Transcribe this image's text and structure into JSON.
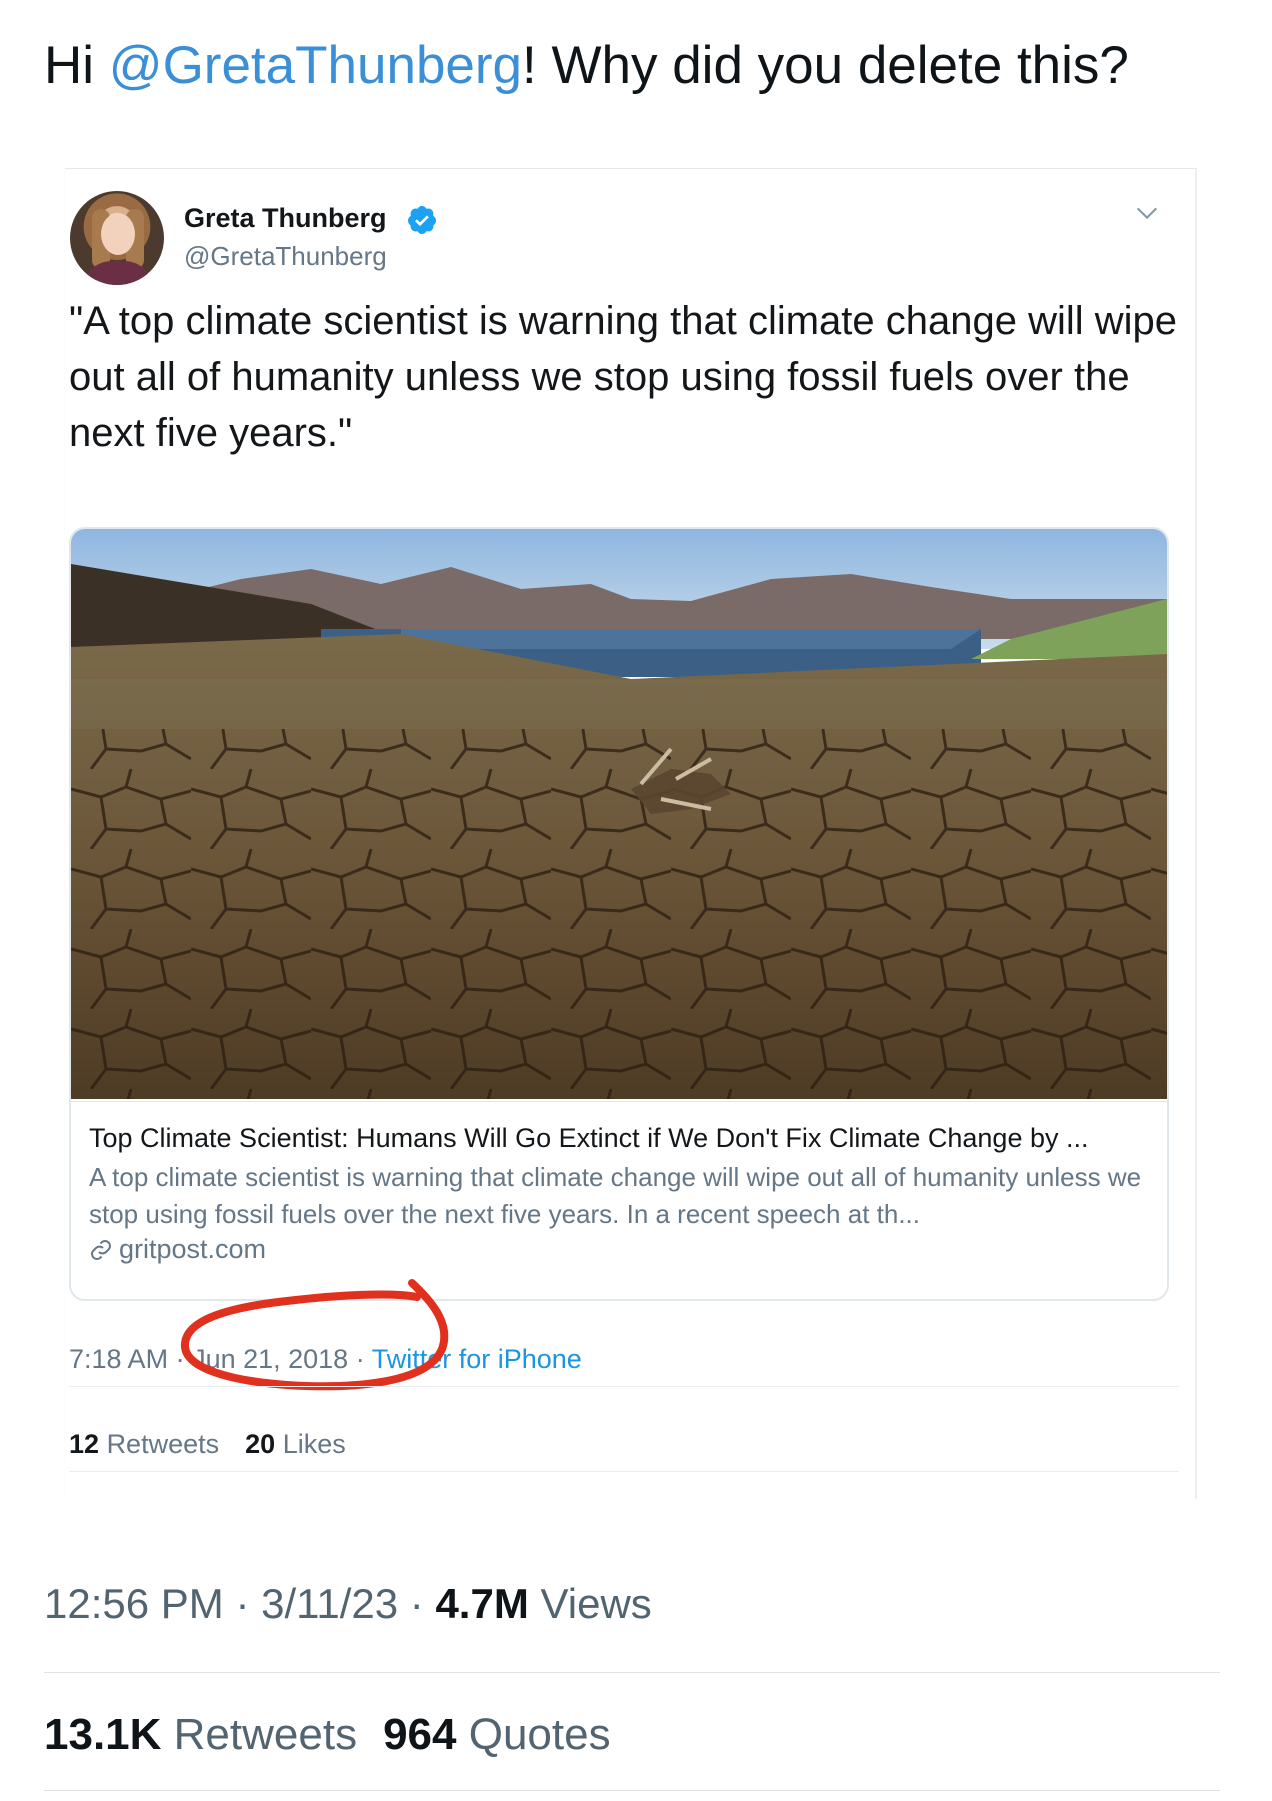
{
  "post": {
    "text_prefix": "Hi ",
    "mention": "@GretaThunberg",
    "text_suffix": "! Why did you delete this?"
  },
  "embedded_tweet": {
    "author_name": "Greta Thunberg",
    "author_handle": "@GretaThunberg",
    "verified": true,
    "text": "\"A top climate scientist is warning that climate change will wipe out all of humanity unless we stop using fossil fuels over the next five years.\"",
    "card": {
      "image_description_icon": "photo-dry-cracked-lakebed",
      "title": "Top Climate Scientist: Humans Will Go Extinct if We Don't Fix Climate Change by ...",
      "description": "A top climate scientist is warning that climate change will wipe out all of humanity unless we stop using fossil fuels over the next five years. In a recent speech at th...",
      "domain": "gritpost.com"
    },
    "time": "7:18 AM",
    "date": "Jun 21, 2018",
    "source": "Twitter for iPhone",
    "retweets_count": "12",
    "retweets_label": "Retweets",
    "likes_count": "20",
    "likes_label": "Likes"
  },
  "meta": {
    "time": "12:56 PM",
    "date": "3/11/23",
    "views_count": "4.7M",
    "views_label": "Views"
  },
  "stats": {
    "retweets_count": "13.1K",
    "retweets_label": "Retweets",
    "quotes_count": "964",
    "quotes_label": "Quotes"
  },
  "colors": {
    "mention": "#3b8fd6",
    "verified": "#1da1f2",
    "annotation_circle": "#e0301e"
  }
}
